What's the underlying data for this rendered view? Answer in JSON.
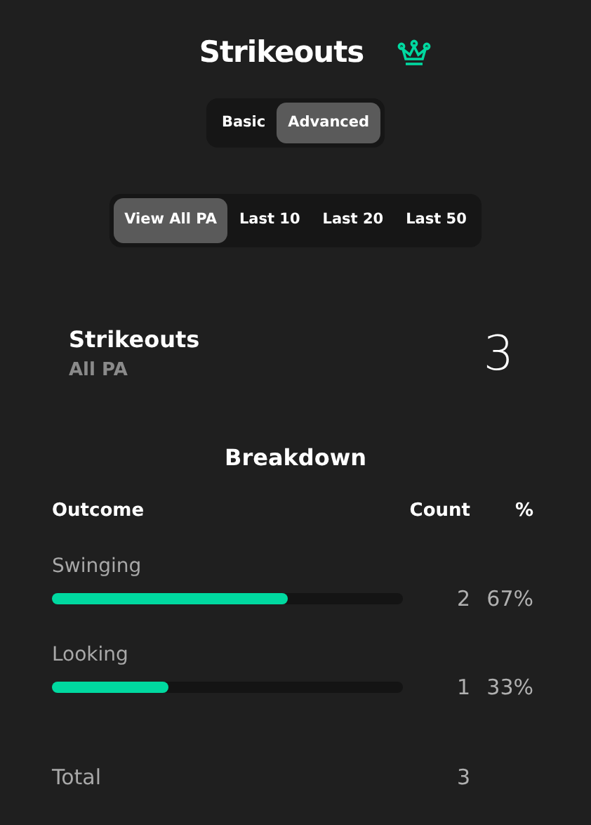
{
  "header": {
    "title": "Strikeouts"
  },
  "mode_toggle": [
    {
      "label": "Basic",
      "selected": false
    },
    {
      "label": "Advanced",
      "selected": true
    }
  ],
  "filters": [
    {
      "label": "View All PA",
      "selected": true
    },
    {
      "label": "Last 10",
      "selected": false
    },
    {
      "label": "Last 20",
      "selected": false
    },
    {
      "label": "Last 50",
      "selected": false
    }
  ],
  "summary": {
    "title": "Strikeouts",
    "subtitle": "All PA",
    "value": "3"
  },
  "breakdown": {
    "title": "Breakdown",
    "columns": [
      "Outcome",
      "Count",
      "%"
    ],
    "rows": [
      {
        "outcome": "Swinging",
        "level": 0.67,
        "count": "2",
        "percent": "67%"
      },
      {
        "outcome": "Looking",
        "level": 0.33,
        "count": "1",
        "percent": "33%"
      }
    ],
    "total": {
      "label": "Total",
      "count": "3"
    }
  }
}
